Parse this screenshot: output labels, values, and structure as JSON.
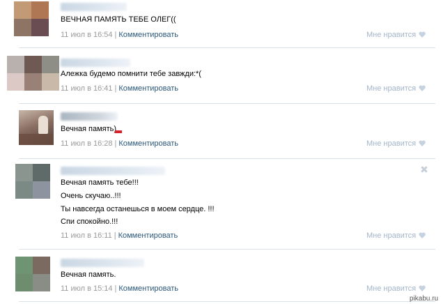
{
  "comments": [
    {
      "text_lines": [
        "ВЕЧНАЯ ПАМЯТЬ ТЕБЕ ОЛЕГ(("
      ],
      "date": "11 июл в 16:54",
      "reply_label": "Комментировать",
      "like_label": "Мне нравится"
    },
    {
      "text_lines": [
        "Алежка будемо помнити тебе завжди:*("
      ],
      "date": "11 июл в 16:41",
      "reply_label": "Комментировать",
      "like_label": "Мне нравится"
    },
    {
      "text_lines": [
        "Вечная память)"
      ],
      "date": "11 июл в 16:28",
      "reply_label": "Комментировать",
      "like_label": "Мне нравится"
    },
    {
      "text_lines": [
        "Вечная память тебе!!!",
        "Очень скучаю..!!!",
        "Ты навсегда останешься в моем сердце. !!!",
        "Спи спокойно.!!!"
      ],
      "date": "11 июл в 16:11",
      "reply_label": "Комментировать",
      "like_label": "Мне нравится",
      "close_glyph": "✖"
    },
    {
      "text_lines": [
        "Вечная память."
      ],
      "date": "11 июл в 15:14",
      "reply_label": "Комментировать",
      "like_label": "Мне нравится"
    }
  ],
  "separator": "|",
  "watermark": "pikabu.ru",
  "colors": {
    "link": "#2b587a",
    "meta": "#999999",
    "like": "#a3b5c9",
    "divider": "#dae1e8"
  },
  "icons": {
    "heart": "heart-icon",
    "close": "close-icon"
  }
}
